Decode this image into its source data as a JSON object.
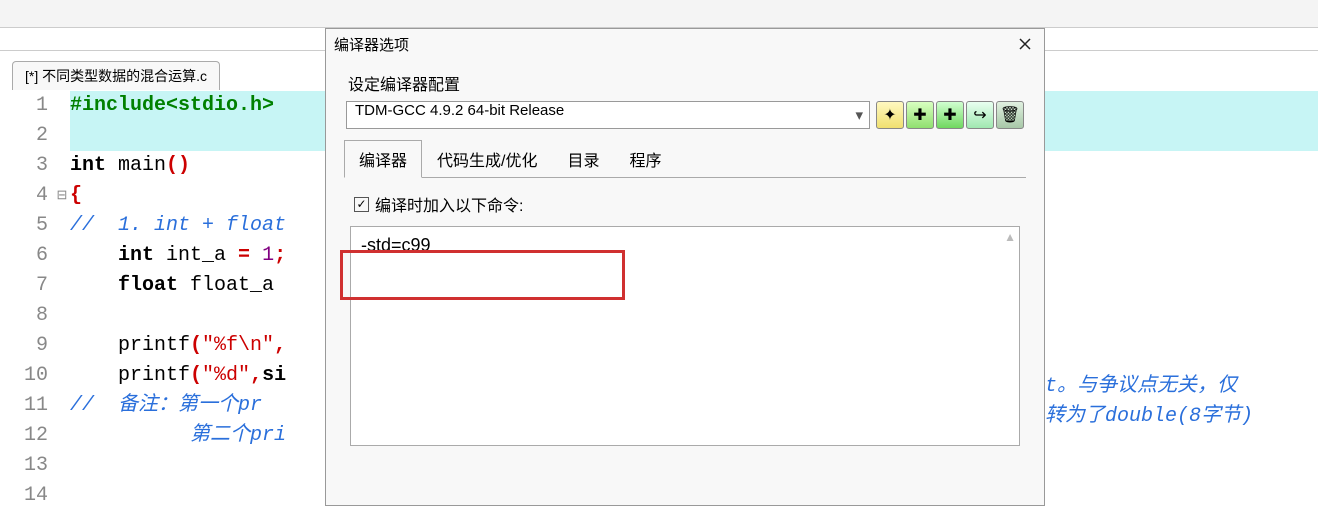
{
  "fileTab": "[*] 不同类型数据的混合运算.c",
  "code": {
    "lines": [
      {
        "n": "1",
        "content": "preproc",
        "text": "#include<stdio.h>",
        "hl": true
      },
      {
        "n": "2",
        "content": "",
        "hl": true
      },
      {
        "n": "3",
        "tokens": [
          {
            "cls": "c-kw",
            "t": "int "
          },
          {
            "cls": "c-ident",
            "t": "main"
          },
          {
            "cls": "c-brace",
            "t": "()"
          }
        ]
      },
      {
        "n": "4",
        "fold": "⊟",
        "tokens": [
          {
            "cls": "c-brace",
            "t": "{"
          }
        ]
      },
      {
        "n": "5",
        "tokens": [
          {
            "cls": "c-cmt",
            "t": "//  1. int + float"
          }
        ]
      },
      {
        "n": "6",
        "tokens": [
          {
            "cls": "",
            "t": "    "
          },
          {
            "cls": "c-kw",
            "t": "int "
          },
          {
            "cls": "c-ident",
            "t": "int_a "
          },
          {
            "cls": "c-op",
            "t": "= "
          },
          {
            "cls": "c-num",
            "t": "1"
          },
          {
            "cls": "c-brace",
            "t": ";"
          }
        ]
      },
      {
        "n": "7",
        "tokens": [
          {
            "cls": "",
            "t": "    "
          },
          {
            "cls": "c-kw",
            "t": "float "
          },
          {
            "cls": "c-ident",
            "t": "float_a"
          }
        ]
      },
      {
        "n": "8",
        "tokens": []
      },
      {
        "n": "9",
        "tokens": [
          {
            "cls": "",
            "t": "    "
          },
          {
            "cls": "c-ident",
            "t": "printf"
          },
          {
            "cls": "c-brace",
            "t": "("
          },
          {
            "cls": "c-str",
            "t": "\"%f\\n\""
          },
          {
            "cls": "c-brace",
            "t": ","
          }
        ]
      },
      {
        "n": "10",
        "tokens": [
          {
            "cls": "",
            "t": "    "
          },
          {
            "cls": "c-ident",
            "t": "printf"
          },
          {
            "cls": "c-brace",
            "t": "("
          },
          {
            "cls": "c-str",
            "t": "\"%d\""
          },
          {
            "cls": "c-brace",
            "t": ","
          },
          {
            "cls": "c-kw",
            "t": "si"
          }
        ]
      },
      {
        "n": "11",
        "tokens": [
          {
            "cls": "c-cmt",
            "t": "//  备注：第一个pr"
          }
        ]
      },
      {
        "n": "12",
        "tokens": [
          {
            "cls": "c-cmt",
            "t": "          第二个pri"
          }
        ]
      },
      {
        "n": "13",
        "tokens": []
      },
      {
        "n": "14",
        "tokens": []
      }
    ]
  },
  "rightFragments": {
    "line11": "t。与争议点无关，仅",
    "line12": "转为了double(8字节)",
    "color": "#2a6fdb"
  },
  "dialog": {
    "title": "编译器选项",
    "sectionLabel": "设定编译器配置",
    "compilerSelected": "TDM-GCC 4.9.2 64-bit Release",
    "buttons": {
      "rename": "✦",
      "addNew": "✚",
      "addCopy": "✚",
      "goto": "↪",
      "delete": "🗑"
    },
    "tabs": {
      "compiler": "编译器",
      "codegen": "代码生成/优化",
      "directories": "目录",
      "programs": "程序"
    },
    "checkboxLabel": "编译时加入以下命令:",
    "checkboxChecked": true,
    "cmdText": "-std=c99"
  }
}
